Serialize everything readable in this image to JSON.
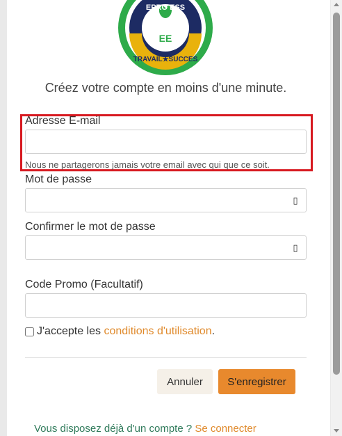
{
  "logo": {
    "top_text": "EPRO     ESS",
    "initials": "EE",
    "motto": "TRAVAIL★SUCCES",
    "colors": {
      "green": "#2eab4a",
      "navy": "#1d2b63",
      "gold": "#e9b20c"
    }
  },
  "form": {
    "subtitle": "Créez votre compte en moins d'une minute.",
    "email": {
      "label": "Adresse E-mail",
      "value": "",
      "placeholder": "",
      "help": "Nous ne partagerons jamais votre email avec qui que ce soit."
    },
    "password": {
      "label": "Mot de passe",
      "value": "",
      "toggle_icon": "▯"
    },
    "confirm_password": {
      "label": "Confirmer le mot de passe",
      "value": "",
      "toggle_icon": "▯"
    },
    "promo": {
      "label": "Code Promo (Facultatif)",
      "value": ""
    },
    "terms": {
      "prefix": "J'accepte les",
      "link": "conditions d'utilisation",
      "suffix": "."
    },
    "buttons": {
      "cancel": "Annuler",
      "register": "S'enregistrer"
    },
    "footer": {
      "text": "Vous disposez déjà d'un compte ?",
      "link": "Se connecter"
    }
  },
  "colors": {
    "accent": "#e8892d",
    "highlight_border": "#d71920",
    "footer_text": "#2f7a5a"
  }
}
